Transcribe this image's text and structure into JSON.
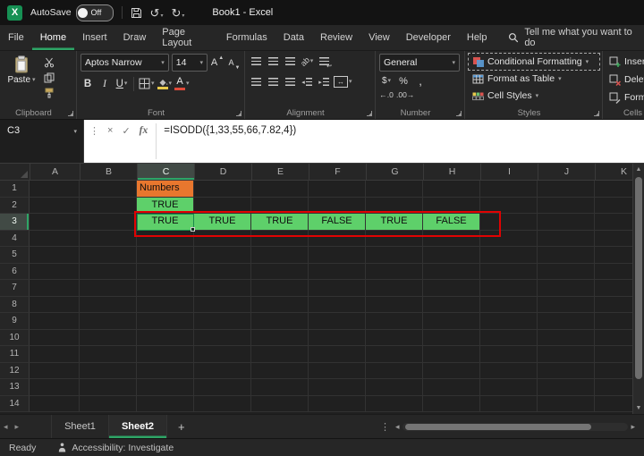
{
  "titlebar": {
    "autosave_label": "AutoSave",
    "autosave_state": "Off",
    "doc_title": "Book1 - Excel"
  },
  "menubar": {
    "tabs": [
      {
        "label": "File",
        "active": false
      },
      {
        "label": "Home",
        "active": true
      },
      {
        "label": "Insert",
        "active": false
      },
      {
        "label": "Draw",
        "active": false
      },
      {
        "label": "Page Layout",
        "active": false
      },
      {
        "label": "Formulas",
        "active": false
      },
      {
        "label": "Data",
        "active": false
      },
      {
        "label": "Review",
        "active": false
      },
      {
        "label": "View",
        "active": false
      },
      {
        "label": "Developer",
        "active": false
      },
      {
        "label": "Help",
        "active": false
      }
    ],
    "search_label": "Tell me what you want to do"
  },
  "ribbon": {
    "clipboard": {
      "paste_label": "Paste",
      "group_label": "Clipboard"
    },
    "font": {
      "font_name": "Aptos Narrow",
      "font_size": "14",
      "bold": "B",
      "italic": "I",
      "underline": "U",
      "group_label": "Font"
    },
    "alignment": {
      "group_label": "Alignment"
    },
    "number": {
      "format": "General",
      "currency": "$",
      "percent": "%",
      "comma": ",",
      "inc_decimal": "←.0",
      "dec_decimal": ".00→",
      "group_label": "Number"
    },
    "styles": {
      "conditional": "Conditional Formatting",
      "format_table": "Format as Table",
      "cell_styles": "Cell Styles",
      "group_label": "Styles"
    },
    "cells": {
      "insert": "Insert",
      "delete": "Delete",
      "format": "Format",
      "group_label": "Cells"
    }
  },
  "formula_bar": {
    "name_box": "C3",
    "formula": "=ISODD({1,33,55,66,7.82,4})"
  },
  "grid": {
    "columns": [
      "A",
      "B",
      "C",
      "D",
      "E",
      "F",
      "G",
      "H",
      "I",
      "J",
      "K"
    ],
    "row_count": 14,
    "selected_column": "C",
    "selected_row": 3,
    "cells": [
      {
        "ref": "C1",
        "text": "Numbers",
        "fill": "orange",
        "align": "left"
      },
      {
        "ref": "C2",
        "text": "TRUE",
        "fill": "green",
        "align": "center"
      },
      {
        "ref": "C3",
        "text": "TRUE",
        "fill": "green",
        "align": "center",
        "active": true
      },
      {
        "ref": "D3",
        "text": "TRUE",
        "fill": "green",
        "align": "center"
      },
      {
        "ref": "E3",
        "text": "TRUE",
        "fill": "green",
        "align": "center"
      },
      {
        "ref": "F3",
        "text": "FALSE",
        "fill": "green",
        "align": "center"
      },
      {
        "ref": "G3",
        "text": "TRUE",
        "fill": "green",
        "align": "center"
      },
      {
        "ref": "H3",
        "text": "FALSE",
        "fill": "green",
        "align": "center"
      }
    ],
    "colors": {
      "green": "#5ED06A",
      "orange": "#E8772E",
      "annotation": "#E00202"
    }
  },
  "sheet_bar": {
    "tabs": [
      {
        "label": "Sheet1",
        "active": false
      },
      {
        "label": "Sheet2",
        "active": true
      }
    ],
    "add_label": "+"
  },
  "status_bar": {
    "mode": "Ready",
    "accessibility": "Accessibility: Investigate"
  }
}
